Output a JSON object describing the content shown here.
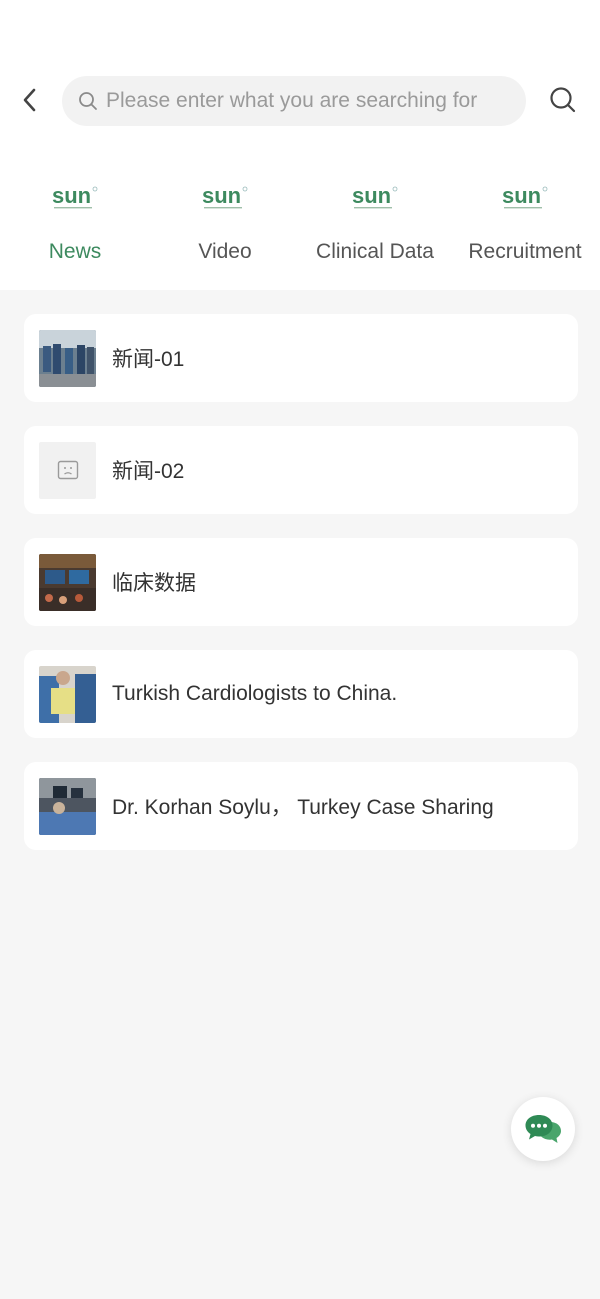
{
  "search": {
    "placeholder": "Please enter what you are searching for"
  },
  "brand": {
    "logo_text": "sun",
    "accent_color": "#3d8a5f"
  },
  "tabs": [
    {
      "label": "News",
      "active": true
    },
    {
      "label": "Video",
      "active": false
    },
    {
      "label": "Clinical Data",
      "active": false
    },
    {
      "label": "Recruitment",
      "active": false
    }
  ],
  "articles": [
    {
      "title": "新闻-01",
      "thumbnail": "photo"
    },
    {
      "title": "新闻-02",
      "thumbnail": "image-placeholder-icon"
    },
    {
      "title": "临床数据",
      "thumbnail": "photo"
    },
    {
      "title": "Turkish Cardiologists to China.",
      "thumbnail": "photo"
    },
    {
      "title": "Dr. Korhan Soylu， Turkey Case Sharing",
      "thumbnail": "photo"
    }
  ],
  "fab": {
    "icon": "chat-icon"
  }
}
